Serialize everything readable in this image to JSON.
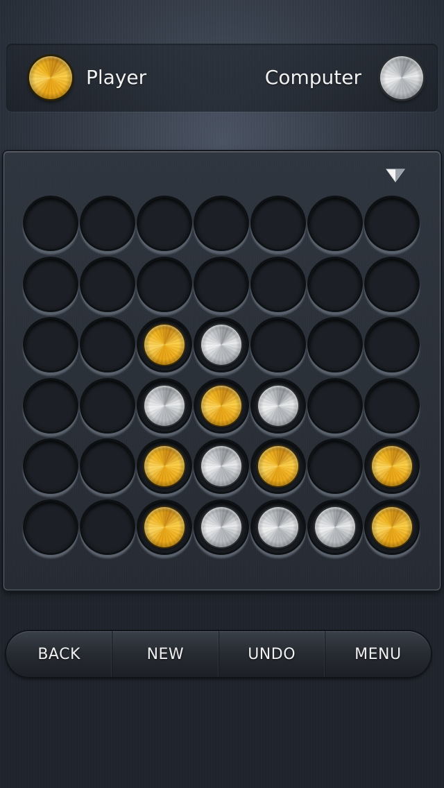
{
  "header": {
    "player_label": "Player",
    "computer_label": "Computer",
    "player_color": "gold",
    "computer_color": "silver"
  },
  "board": {
    "columns": 7,
    "rows": 6,
    "drop_indicator_icon": "triangle-down-icon",
    "grid": [
      [
        "empty",
        "empty",
        "empty",
        "empty",
        "empty",
        "empty",
        "empty"
      ],
      [
        "empty",
        "empty",
        "empty",
        "empty",
        "empty",
        "empty",
        "empty"
      ],
      [
        "empty",
        "empty",
        "gold",
        "silver",
        "empty",
        "empty",
        "empty"
      ],
      [
        "empty",
        "empty",
        "silver",
        "gold",
        "silver",
        "empty",
        "empty"
      ],
      [
        "empty",
        "empty",
        "gold",
        "silver",
        "gold",
        "empty",
        "gold"
      ],
      [
        "empty",
        "empty",
        "gold",
        "silver",
        "silver",
        "silver",
        "gold"
      ]
    ]
  },
  "toolbar": {
    "buttons": [
      {
        "label": "BACK"
      },
      {
        "label": "NEW"
      },
      {
        "label": "UNDO"
      },
      {
        "label": "MENU"
      }
    ]
  },
  "colors": {
    "gold": "#f3b315",
    "silver": "#d4d6d9",
    "background": "#2c323b"
  }
}
